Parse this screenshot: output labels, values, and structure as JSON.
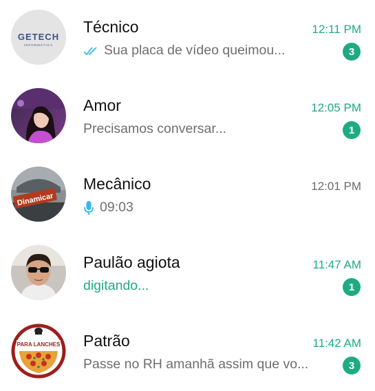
{
  "chats": [
    {
      "name": "Técnico",
      "time": "12:11 PM",
      "preview": "Sua placa de vídeo queimou...",
      "unread": "3",
      "avatar_text": "GETECH",
      "avatar_subtext": "INFORMÁTICA",
      "status_icon": "double-check-icon"
    },
    {
      "name": "Amor",
      "time": "12:05 PM",
      "preview": "Precisamos conversar...",
      "unread": "1"
    },
    {
      "name": "Mecânico",
      "time": "12:01 PM",
      "preview": "09:03",
      "avatar_text": "Dinamicar",
      "status_icon": "microphone-icon"
    },
    {
      "name": "Paulão agiota",
      "time": "11:47 AM",
      "preview": "digitando...",
      "unread": "1"
    },
    {
      "name": "Patrão",
      "time": "11:42 AM",
      "preview": "Passe no RH amanhã assim que vo...",
      "unread": "3",
      "avatar_text": "PARA LANCHES"
    }
  ],
  "colors": {
    "accent": "#1eab83",
    "tick": "#34b7f1",
    "preview_text": "#6e6e6e"
  }
}
